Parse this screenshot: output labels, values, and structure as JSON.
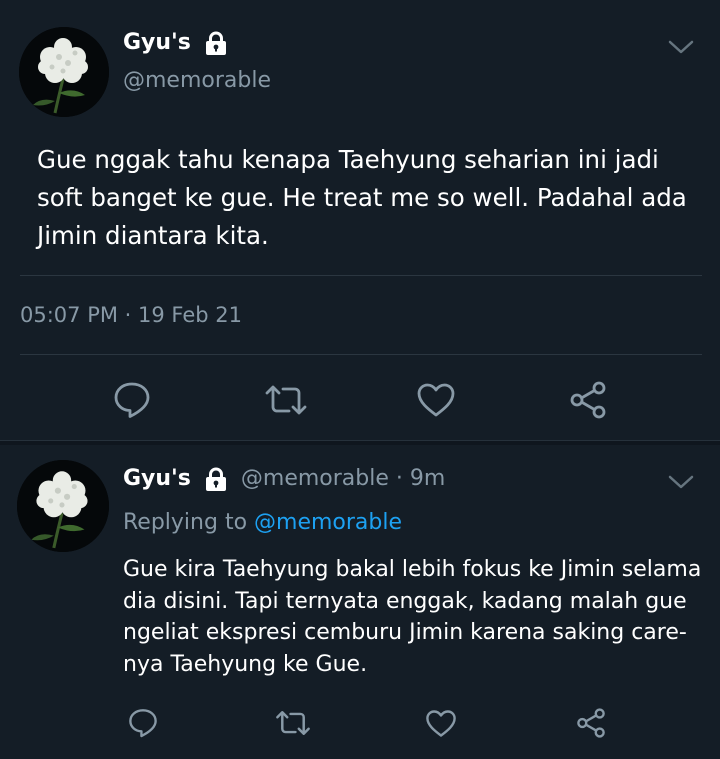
{
  "main_tweet": {
    "display_name": "Gyu's",
    "handle": "@memorable",
    "text": "Gue nggak tahu kenapa Taehyung seharian ini jadi soft banget ke gue. He treat me so well. Padahal ada Jimin diantara kita.",
    "timestamp": "05:07 PM · 19 Feb 21"
  },
  "reply_tweet": {
    "display_name": "Gyu's",
    "handle_time": "@memorable · 9m",
    "replying_to_prefix": "Replying to ",
    "replying_to_handle": "@memorable",
    "text": "Gue kira Taehyung bakal lebih fokus ke Jimin selama dia disini. Tapi ternyata enggak, kadang malah gue ngeliat ekspresi cemburu Jimin karena saking care-nya Taehyung ke Gue."
  },
  "icons": {
    "lock": "lock-icon",
    "chevron": "chevron-down-icon",
    "reply": "reply-icon",
    "retweet": "retweet-icon",
    "like": "heart-icon",
    "share": "share-icon"
  },
  "colors": {
    "background": "#141d26",
    "text_primary": "#ffffff",
    "text_secondary": "#8899a6",
    "link": "#1da1f2",
    "divider": "#2b3640"
  }
}
